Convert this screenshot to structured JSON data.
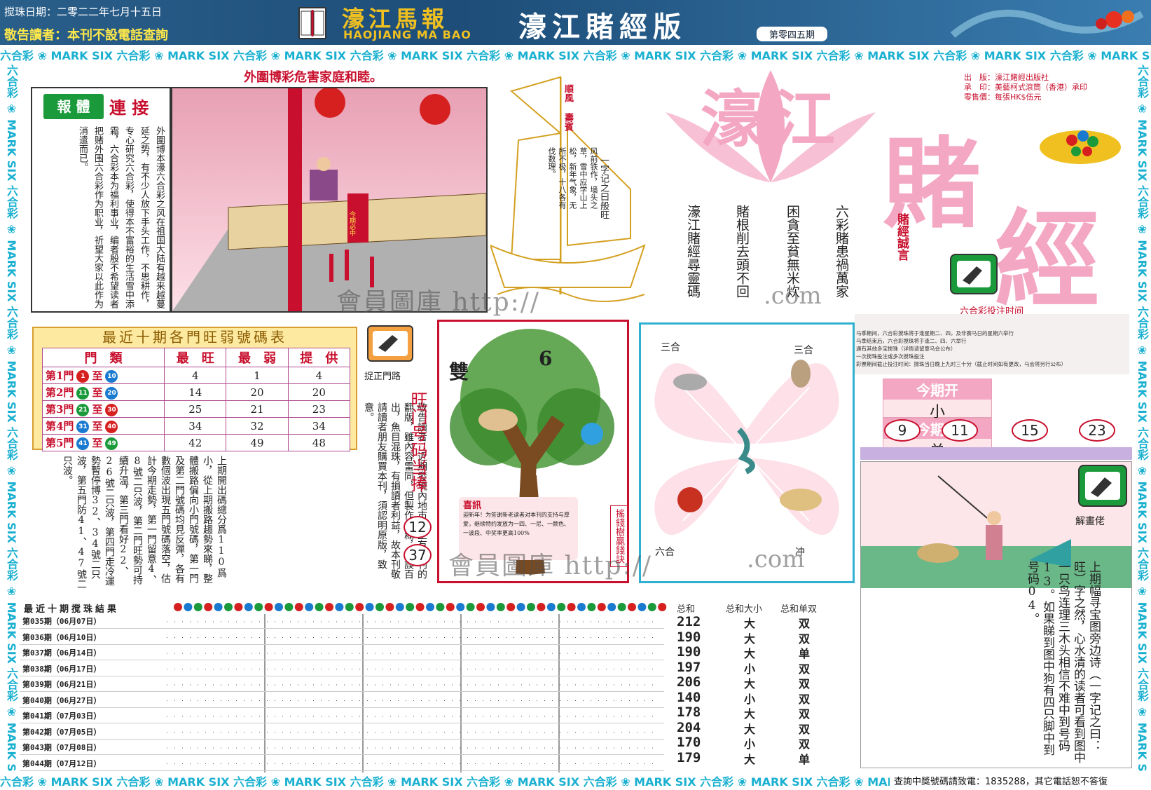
{
  "header": {
    "date": "搅珠日期：二零二二年七月十五日",
    "notice": "敬告讀者：本刊不設電話查詢",
    "logo_cn": "濠江馬報",
    "logo_en": "HAOJIANG MA BAO",
    "edition_title": "濠江賭經版",
    "issue": "第零四五期"
  },
  "strip_text": "六合彩 ❀ MARK SIX 六合彩 ❀ MARK SIX 六合彩 ❀ MARK SIX 六合彩 ❀ MARK SIX 六合彩 ❀ MARK SIX 六合彩 ❀ MARK SIX 六合彩 ❀ MARK SIX 六合彩 ❀ MARK SIX 六合彩 ❀ MARK SIX 六合彩 ❀ MARK SIX",
  "panel1": {
    "warning": "外圍博彩危害家庭和睦。",
    "badge": "報 體",
    "link": "連 接",
    "body": "外圍博本濠六合彩之风在祖国大陆有越来越蔓延之势，有不少人放下手头工作，不思耕作，专心研究六合彩，使得本不富裕的生活雪中添霜，六合彩本为福利事业，编者殷不希望读者把赌外围六合彩作为职业，祈望大家以此作为消遣而已。",
    "scene_banner": "今期必中"
  },
  "boat": {
    "flag": "順風 壽賓",
    "sail_text": "风前铁作，墙头之草，雪中应学山上松，新年气象，无所不极，十八各有伐数理。",
    "poem": "一字记之曰般旺"
  },
  "masthead": {
    "title1": "濠江",
    "title2": "賭",
    "title3": "經",
    "publisher": [
      "出　版：濠江賭經出版社",
      "承　印：美藝柯式滾筒（香港）承印",
      "零售價：每張HK$伍元"
    ],
    "verses": [
      "六彩賭患禍萬家",
      "困貪至貧無米炊",
      "賭根削去頭不回",
      "濠江賭經尋靈碼"
    ],
    "motto": "賭經誠言"
  },
  "bet_time": {
    "title": "六合彩投注时间",
    "notes": [
      "马季期间，六合彩搅珠将于逢星期二、四，及非赛马日的星期六举行",
      "马季结束后，六合彩搅珠将于逢二、四、六举行",
      "遇有其他多宝搅珠（详情请留意马会公布）",
      "一次搅珠投注或多次搅珠投注",
      "彩票期间截止投注时间：搅珠当日晚上九时三十分（截止时间如有更改，马会将另行公布）"
    ]
  },
  "open": {
    "label1": "今期开",
    "label2": "今期开",
    "value1": "小",
    "value2": "单",
    "numbers": [
      "9",
      "11",
      "15",
      "23"
    ]
  },
  "stats": {
    "title": "最近十期各門旺弱號碼表",
    "headers": [
      "門　類",
      "最　旺",
      "最　弱",
      "提　供"
    ],
    "rows": [
      {
        "gate": "第1門",
        "from": "1",
        "to": "10",
        "hot": "4",
        "cold": "1",
        "tip": "4",
        "c1": "#d62020",
        "c2": "#1a7ad0"
      },
      {
        "gate": "第2門",
        "from": "11",
        "to": "20",
        "hot": "14",
        "cold": "20",
        "tip": "20",
        "c1": "#1a9a3a",
        "c2": "#1a7ad0"
      },
      {
        "gate": "第3門",
        "from": "21",
        "to": "30",
        "hot": "25",
        "cold": "21",
        "tip": "23",
        "c1": "#1a9a3a",
        "c2": "#d62020"
      },
      {
        "gate": "第4門",
        "from": "31",
        "to": "40",
        "hot": "34",
        "cold": "32",
        "tip": "34",
        "c1": "#1a7ad0",
        "c2": "#d62020"
      },
      {
        "gate": "第5門",
        "from": "41",
        "to": "49",
        "hot": "42",
        "cold": "49",
        "tip": "48",
        "c1": "#1a7ad0",
        "c2": "#1a9a3a"
      }
    ]
  },
  "gate_notes": "上期開出碼總分爲110爲小，從上期搬路趨勢來睇，整體搬路偏向小門號碼，第一門及第二門號碼均見反彈，各有數個波出現五門號碼落空，估計今期走勢，第一門留意4、8號二只波，第二門旺勢可持續升温，第三門看好22、26號二只波，第四門走冷運勢暫停博32、34號二只波，第五門防41、47號二只波。",
  "pick_gate": "捉正門路",
  "reader_notice": "敬告讀者：近期發現內地市場上有本刊的翻版，雖內容雷同，但製作模糊，錯誤百出，魚目混珠，有損讀者利益，故本刊敬請讀者朋友購買本刊，須認明原版，致意。",
  "hot_gate": {
    "title": "旺门号码当捧",
    "numbers": [
      "12",
      "37"
    ]
  },
  "tree": {
    "left_label": "雙",
    "num": "6",
    "xi_xun_title": "喜訊",
    "xi_xun_body": "迎新年！为答谢新老读者对本刊的支持与厚爱，继续特约发放为一四、一尼、一颜色、一波段、中奖率更高100%",
    "side": "搖錢樹贏錢訣"
  },
  "butterfly": {
    "tl": "三合",
    "tr": "三合",
    "bl": "六合",
    "br": "冲"
  },
  "scene2_label": "解畫佬",
  "riddle": "上期幅寻宝图旁边诗（一字记之曰：旺）字之然，心水清的读者可看到图中一只鸟连理三木头相信不难中到号码13。如果睇到图中狗有四只脚中到号码04。",
  "results": {
    "title": "最近十期搅珠結果",
    "sum_head": [
      "总和",
      "总和大小",
      "总和单双"
    ],
    "rows": [
      {
        "label": "第035期（06月07日）",
        "sum": "212",
        "sz": "大",
        "oe": "双"
      },
      {
        "label": "第036期（06月10日）",
        "sum": "190",
        "sz": "大",
        "oe": "双"
      },
      {
        "label": "第037期（06月14日）",
        "sum": "190",
        "sz": "大",
        "oe": "单"
      },
      {
        "label": "第038期（06月17日）",
        "sum": "197",
        "sz": "小",
        "oe": "双"
      },
      {
        "label": "第039期（06月21日）",
        "sum": "206",
        "sz": "大",
        "oe": "双"
      },
      {
        "label": "第040期（06月27日）",
        "sum": "140",
        "sz": "小",
        "oe": "双"
      },
      {
        "label": "第041期（07月03日）",
        "sum": "178",
        "sz": "大",
        "oe": "双"
      },
      {
        "label": "第042期（07月05日）",
        "sum": "204",
        "sz": "大",
        "oe": "双"
      },
      {
        "label": "第043期（07月08日）",
        "sum": "170",
        "sz": "小",
        "oe": "双"
      },
      {
        "label": "第044期（07月12日）",
        "sum": "179",
        "sz": "大",
        "oe": "单"
      }
    ]
  },
  "footer_note": "查詢中獎號碼請致電：1835288，其它電話恕不答復",
  "watermark": {
    "text": "會員圖庫 http://",
    "com": ".com"
  }
}
